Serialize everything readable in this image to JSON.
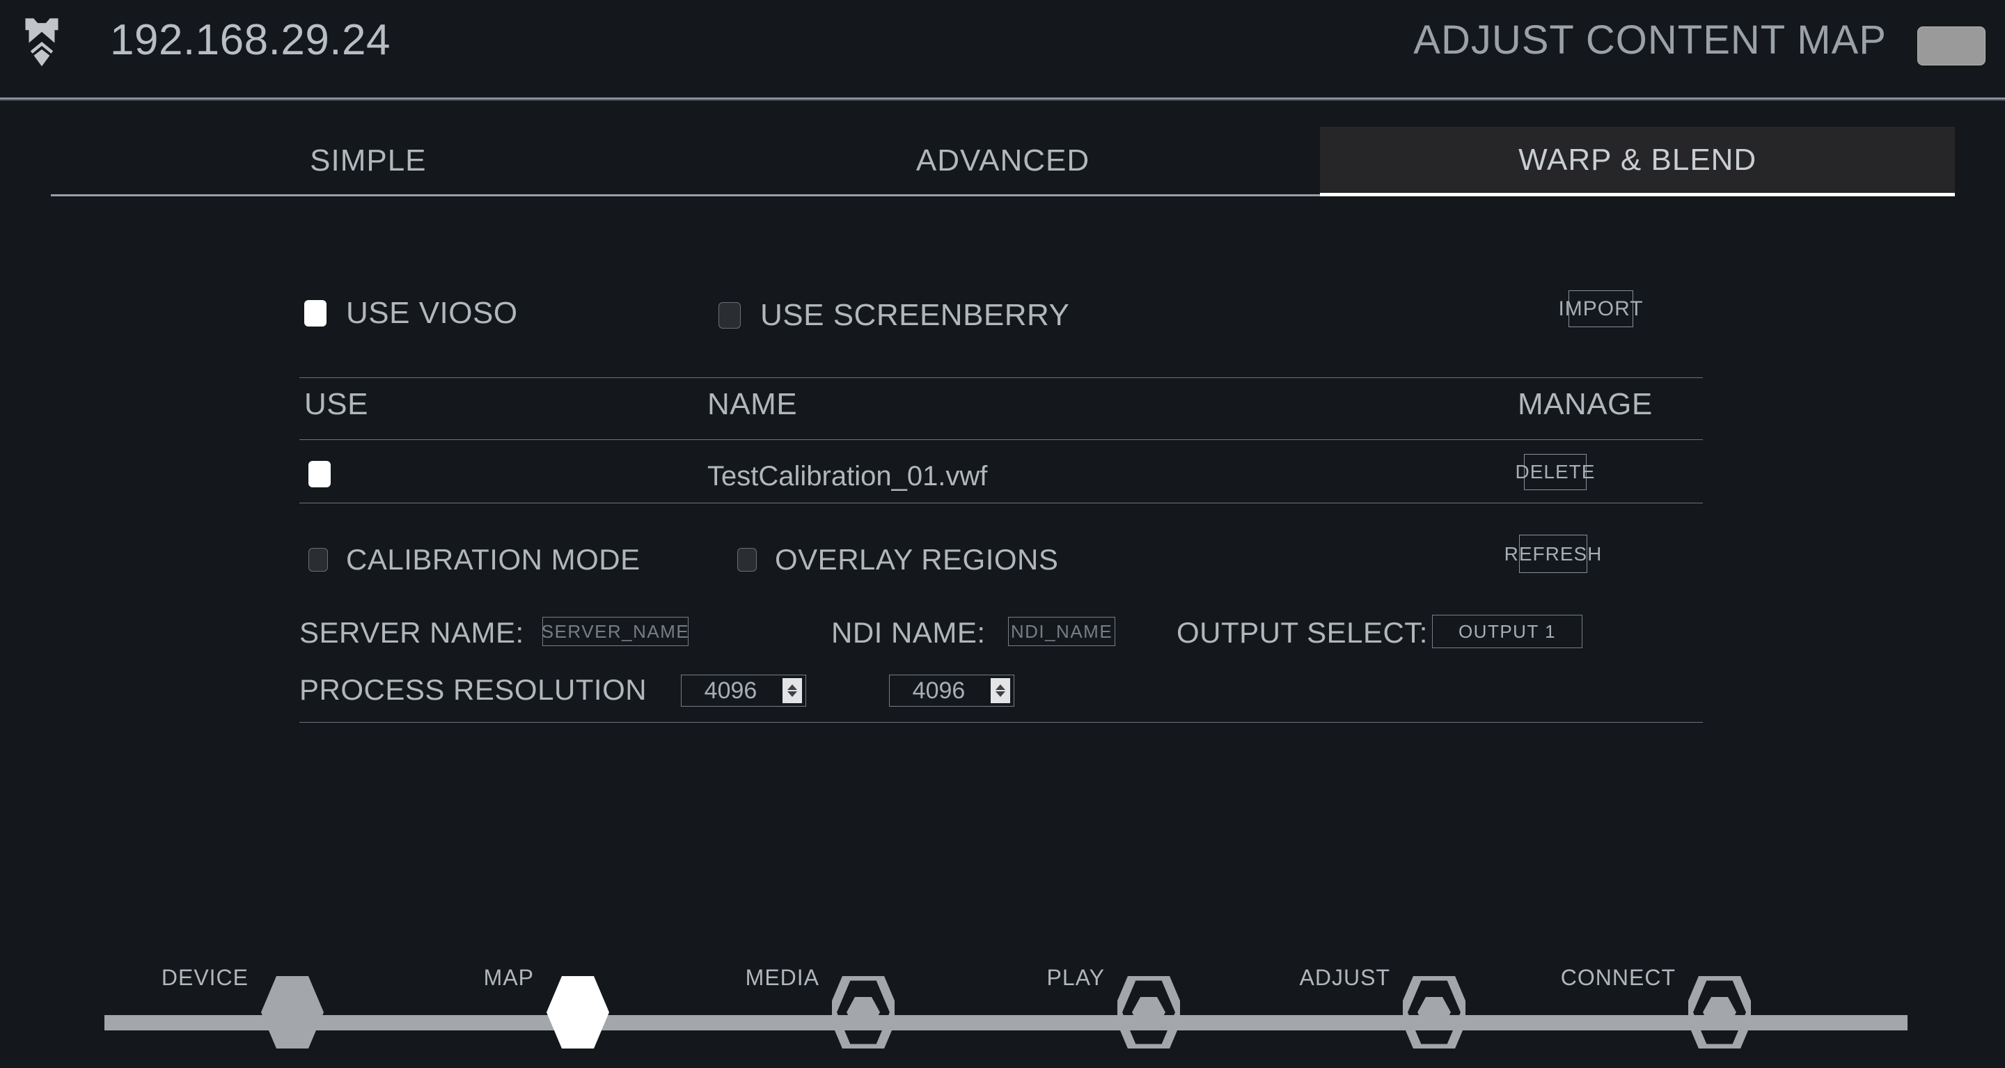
{
  "header": {
    "logo_icon": "shield-chevron-logo",
    "ip_address": "192.168.29.24",
    "title": "ADJUST CONTENT MAP",
    "corner_button_label": ""
  },
  "tabs": [
    {
      "label": "SIMPLE",
      "active": false
    },
    {
      "label": "ADVANCED",
      "active": false
    },
    {
      "label": "WARP & BLEND",
      "active": true
    }
  ],
  "warp_blend": {
    "engine_toggles": [
      {
        "label": "USE VIOSO",
        "checked": true
      },
      {
        "label": "USE SCREENBERRY",
        "checked": false
      }
    ],
    "import_label": "IMPORT",
    "table": {
      "columns": [
        "USE",
        "NAME",
        "MANAGE"
      ],
      "rows": [
        {
          "use_checked": true,
          "name": "TestCalibration_01.vwf",
          "manage_label": "DELETE"
        }
      ]
    },
    "mode_toggles": [
      {
        "label": "CALIBRATION MODE",
        "checked": false
      },
      {
        "label": "OVERLAY REGIONS",
        "checked": false
      }
    ],
    "refresh_label": "REFRESH",
    "server_name": {
      "label": "SERVER NAME:",
      "value": "",
      "placeholder": "SERVER_NAME"
    },
    "ndi_name": {
      "label": "NDI NAME:",
      "value": "",
      "placeholder": "NDI_NAME"
    },
    "output_select": {
      "label": "OUTPUT SELECT:",
      "value": "OUTPUT 1"
    },
    "process_resolution": {
      "label": "PROCESS RESOLUTION",
      "width_value": "4096",
      "height_value": "4096"
    }
  },
  "stepper": {
    "steps": [
      {
        "label": "DEVICE",
        "state": "complete"
      },
      {
        "label": "MAP",
        "state": "current"
      },
      {
        "label": "MEDIA",
        "state": "pending"
      },
      {
        "label": "PLAY",
        "state": "pending"
      },
      {
        "label": "ADJUST",
        "state": "pending"
      },
      {
        "label": "CONNECT",
        "state": "pending"
      }
    ]
  },
  "colors": {
    "background": "#14181c",
    "text": "#b2b7bc",
    "accent": "#ffffff",
    "rule": "#6d737a",
    "active_tab_bg": "#262628",
    "stepper_line": "#a3a7ab"
  }
}
